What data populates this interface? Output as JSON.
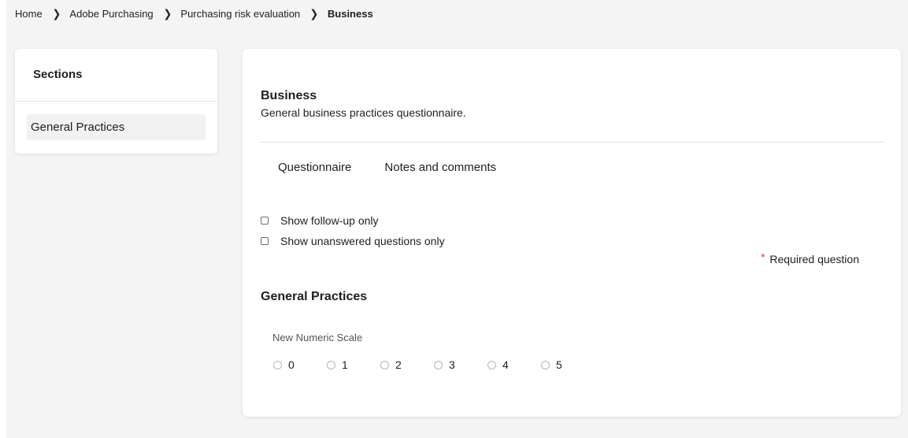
{
  "breadcrumb": {
    "items": [
      "Home",
      "Adobe Purchasing",
      "Purchasing risk evaluation",
      "Business"
    ],
    "separator_icon": "chevron-right-icon"
  },
  "sidebar": {
    "title": "Sections",
    "items": [
      {
        "label": "General Practices"
      }
    ]
  },
  "main": {
    "title": "Business",
    "description": "General business practices questionnaire.",
    "tabs": [
      {
        "label": "Questionnaire"
      },
      {
        "label": "Notes and comments"
      }
    ],
    "filters": [
      {
        "label": "Show follow-up only",
        "checked": false
      },
      {
        "label": "Show unanswered questions only",
        "checked": false
      }
    ],
    "required_note": {
      "star": "*",
      "text": "Required question"
    },
    "section_heading": "General Practices",
    "question": {
      "label": "New Numeric Scale",
      "options": [
        "0",
        "1",
        "2",
        "3",
        "4",
        "5"
      ],
      "selected": null
    }
  },
  "colors": {
    "page_background": "#f4f4f4",
    "card_background": "#ffffff",
    "selected_section_background": "#f1f1f1",
    "required_star": "#e02424"
  }
}
